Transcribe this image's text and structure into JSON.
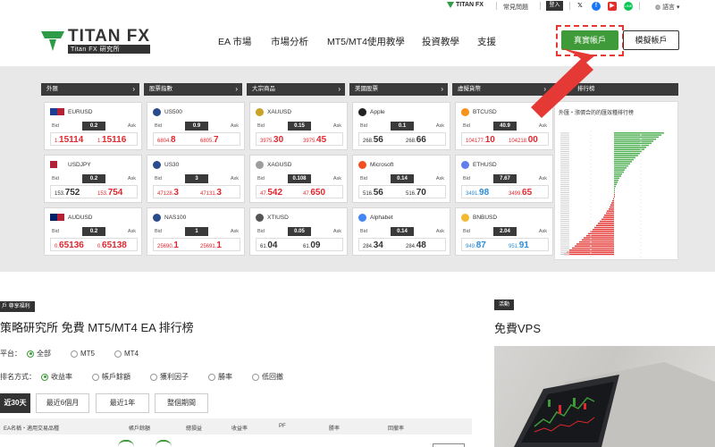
{
  "utility_bar": {
    "logo_text": "TITAN FX",
    "faq": "常見問題",
    "login": "登入",
    "social": [
      "x-icon",
      "facebook-icon",
      "youtube-icon",
      "line-icon"
    ],
    "language": "語言"
  },
  "header": {
    "brand_name": "TITAN FX",
    "brand_sub": "Titan FX 研究所",
    "nav": [
      "EA 市場",
      "市場分析",
      "MT5/MT4使用教學",
      "投資教學",
      "支援"
    ],
    "real_account": "真實帳戶",
    "demo_account": "模擬帳戶"
  },
  "columns": [
    {
      "title": "外匯"
    },
    {
      "title": "股票指數"
    },
    {
      "title": "大宗商品"
    },
    {
      "title": "美國股票"
    },
    {
      "title": "虛擬貨幣"
    }
  ],
  "cards": [
    [
      {
        "symbol": "EURUSD",
        "spread": "0.2",
        "bid_small": "1.",
        "bid_big": "15114",
        "ask_small": "1.",
        "ask_big": "15116",
        "color": "red"
      },
      {
        "symbol": "USDJPY",
        "spread": "0.2",
        "bid_small": "153.",
        "bid_big": "752",
        "ask_small": "153.",
        "ask_big": "754",
        "color": "dark-red"
      },
      {
        "symbol": "AUDUSD",
        "spread": "0.2",
        "bid_small": "0.",
        "bid_big": "65136",
        "ask_small": "0.",
        "ask_big": "65138",
        "color": "red"
      }
    ],
    [
      {
        "symbol": "US500",
        "spread": "0.9",
        "bid_small": "6804.",
        "bid_big": "8",
        "ask_small": "6805.",
        "ask_big": "7",
        "color": "red"
      },
      {
        "symbol": "US30",
        "spread": "3",
        "bid_small": "47128.",
        "bid_big": "3",
        "ask_small": "47131.",
        "ask_big": "3",
        "color": "red"
      },
      {
        "symbol": "NAS100",
        "spread": "1",
        "bid_small": "25690.",
        "bid_big": "1",
        "ask_small": "25691.",
        "ask_big": "1",
        "color": "red"
      }
    ],
    [
      {
        "symbol": "XAUUSD",
        "spread": "0.15",
        "bid_small": "3975.",
        "bid_big": "30",
        "ask_small": "3975.",
        "ask_big": "45",
        "color": "red"
      },
      {
        "symbol": "XAGUSD",
        "spread": "0.108",
        "bid_small": "47.",
        "bid_big": "542",
        "ask_small": "47.",
        "ask_big": "650",
        "color": "red"
      },
      {
        "symbol": "XTIUSD",
        "spread": "0.05",
        "bid_small": "61.",
        "bid_big": "04",
        "ask_small": "61.",
        "ask_big": "09",
        "color": "dark"
      }
    ],
    [
      {
        "symbol": "Apple",
        "spread": "0.1",
        "bid_small": "268.",
        "bid_big": "56",
        "ask_small": "268.",
        "ask_big": "66",
        "color": "dark"
      },
      {
        "symbol": "Microsoft",
        "spread": "0.14",
        "bid_small": "516.",
        "bid_big": "56",
        "ask_small": "516.",
        "ask_big": "70",
        "color": "dark"
      },
      {
        "symbol": "Alphabet",
        "spread": "0.14",
        "bid_small": "284.",
        "bid_big": "34",
        "ask_small": "284.",
        "ask_big": "48",
        "color": "dark"
      }
    ],
    [
      {
        "symbol": "BTCUSD",
        "spread": "40.9",
        "bid_small": "104177.",
        "bid_big": "10",
        "ask_small": "104218.",
        "ask_big": "00",
        "color": "red"
      },
      {
        "symbol": "ETHUSD",
        "spread": "7.67",
        "bid_small": "3491.",
        "bid_big": "98",
        "ask_small": "3499.",
        "ask_big": "65",
        "color": "blue-red"
      },
      {
        "symbol": "BNBUSD",
        "spread": "2.04",
        "bid_small": "949.",
        "bid_big": "87",
        "ask_small": "951.",
        "ask_big": "91",
        "color": "blue"
      }
    ]
  ],
  "labels": {
    "bid": "Bid",
    "ask": "Ask"
  },
  "ranking": {
    "head": "排行榜",
    "title": "外匯・漲價合的的匯效種排行榜"
  },
  "ea_section": {
    "badge": "戶 尊享福利",
    "heading": "策略研究所 免費 MT5/MT4 EA 排行榜",
    "platform_label": "平台：",
    "platform_options": [
      {
        "label": "全部",
        "on": true
      },
      {
        "label": "MT5",
        "on": false
      },
      {
        "label": "MT4",
        "on": false
      }
    ],
    "sort_label": "排名方式：",
    "sort_options": [
      {
        "label": "收益率",
        "on": true
      },
      {
        "label": "帳戶餘額",
        "on": false
      },
      {
        "label": "獲利因子",
        "on": false
      },
      {
        "label": "勝率",
        "on": false
      },
      {
        "label": "低回撤",
        "on": false
      }
    ],
    "tabs": [
      "近30天",
      "最近6個月",
      "最近1年",
      "整個期間"
    ],
    "table_headers": [
      "EA名稱・適用交易品種",
      "帳戶餘額",
      "總損益",
      "收益率",
      "PF",
      "勝率",
      "回撤率"
    ]
  },
  "vps_section": {
    "badge": "活動",
    "heading": "免費VPS"
  }
}
